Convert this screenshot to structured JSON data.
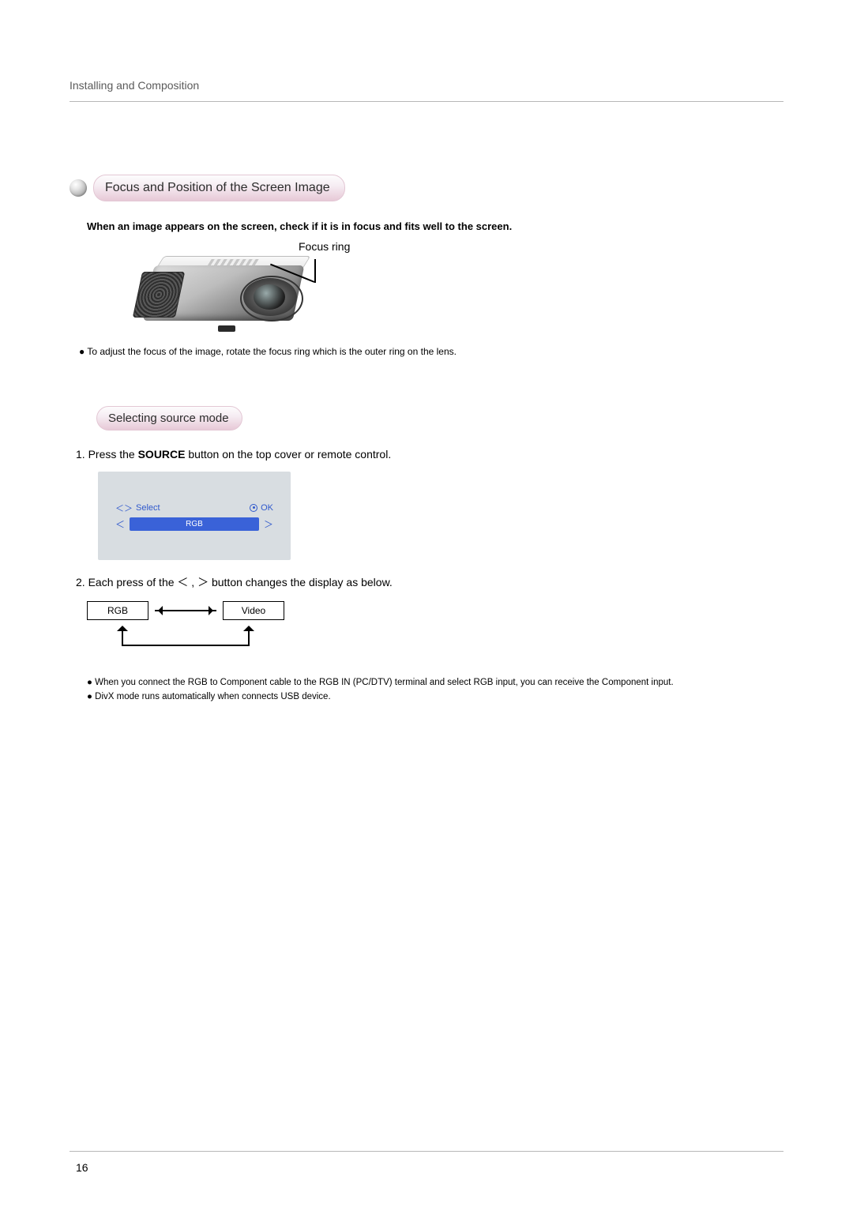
{
  "header": {
    "running_head": "Installing and Composition"
  },
  "page_number": "16",
  "section1": {
    "title": "Focus and Position of the Screen Image",
    "lead": "When an image appears on the screen, check if it is in focus and fits well to the screen.",
    "figure_label": "Focus ring",
    "bullet": "● To adjust the focus of the image, rotate the focus ring which is the outer ring on the lens."
  },
  "section2": {
    "title": "Selecting source mode",
    "step1_pre": "1. Press the ",
    "step1_bold": "SOURCE",
    "step1_post": " button on the top cover or remote control.",
    "osd": {
      "select_label": "Select",
      "ok_label": "OK",
      "value": "RGB",
      "lt": "＜",
      "gt": "＞",
      "pair": "＜＞"
    },
    "step2_pre": "2. Each press of the ",
    "step2_sym": "＜ , ＞",
    "step2_post": " button changes the display as below.",
    "cycle": {
      "left": "RGB",
      "right": "Video"
    },
    "notes": [
      "● When you connect the RGB to Component cable to the RGB IN (PC/DTV) terminal and select RGB input, you can receive the Component input.",
      "● DivX mode runs automatically when connects USB device."
    ]
  }
}
